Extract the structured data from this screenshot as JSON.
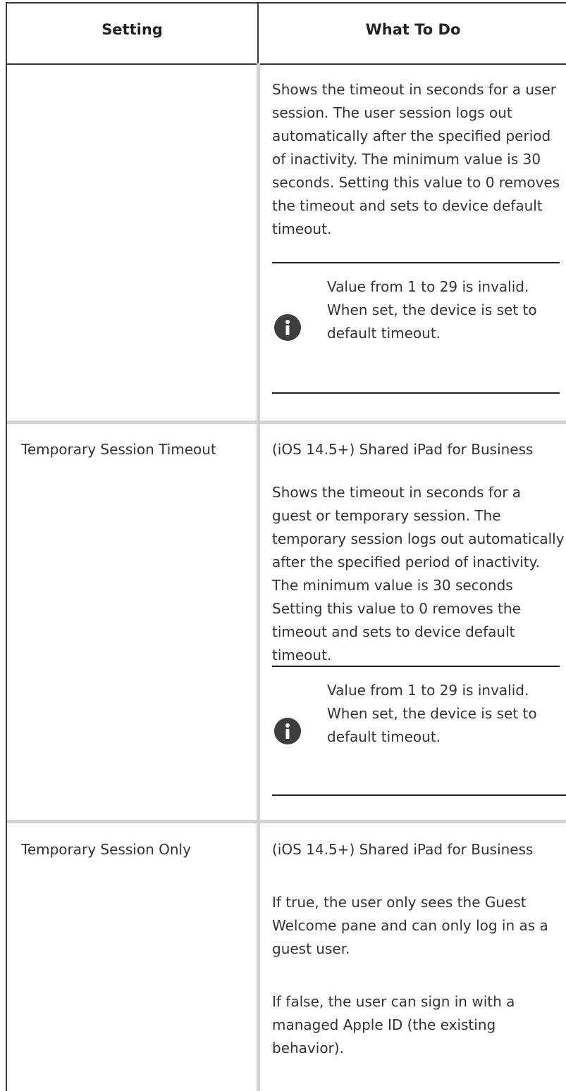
{
  "table": {
    "headers": {
      "setting": "Setting",
      "what_to_do": "What To Do"
    },
    "rows": [
      {
        "setting": "",
        "paragraphs": [
          "Shows the timeout in seconds for a user session. The user session logs out automatically after the specified period of inactivity. The minimum value is 30 seconds. Setting this value to 0 removes the timeout and sets to device default timeout."
        ],
        "note": "Value from 1 to 29 is invalid. When set, the device is set to default timeout."
      },
      {
        "setting": "Temporary Session Timeout",
        "paragraphs": [
          "(iOS 14.5+) Shared iPad for Business",
          "Shows the timeout in seconds for a guest or temporary session. The temporary session logs out automatically after the specified period of inactivity. The minimum value is 30 seconds Setting this value to 0 removes the timeout and sets to device default timeout."
        ],
        "note": "Value from 1 to 29 is invalid. When set, the device is set to default timeout."
      },
      {
        "setting": "Temporary Session Only",
        "paragraphs": [
          "(iOS 14.5+) Shared iPad for Business",
          "If true, the user only sees the Guest Welcome pane and can only log in as a guest user.",
          "If false, the user can sign in with a managed Apple ID (the existing behavior)."
        ],
        "note": ""
      }
    ]
  },
  "icons": {
    "note": "info-icon"
  }
}
